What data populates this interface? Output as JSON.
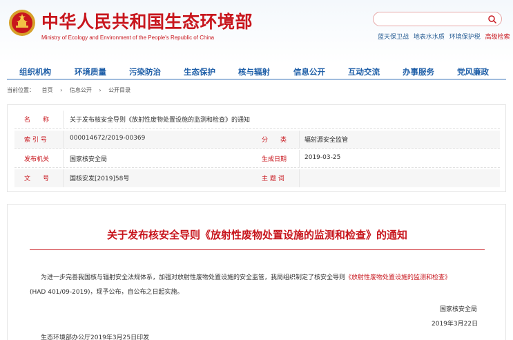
{
  "header": {
    "site_title": "中华人民共和国生态环境部",
    "site_subtitle": "Ministry of Ecology and Environment of the People's Republic of China",
    "search": {
      "placeholder": ""
    },
    "quick_links": [
      "蓝天保卫战",
      "地表水水质",
      "环境保护税"
    ],
    "advanced_search": "高级检索"
  },
  "nav": {
    "items": [
      "组织机构",
      "环境质量",
      "污染防治",
      "生态保护",
      "核与辐射",
      "信息公开",
      "互动交流",
      "办事服务",
      "党风廉政"
    ]
  },
  "breadcrumb": {
    "prefix": "当前位置：",
    "items": [
      "首页",
      "信息公开",
      "公开目录"
    ]
  },
  "info": {
    "name_label": "名　　称",
    "name_value": "关于发布核安全导则《放射性废物处置设施的监测和检查》的通知",
    "index_label": "索 引 号",
    "index_value": "000014672/2019-00369",
    "category_label": "分　　类",
    "category_value": "辐射源安全监管",
    "issuer_label": "发布机关",
    "issuer_value": "国家核安全局",
    "date_label": "生成日期",
    "date_value": "2019-03-25",
    "doc_label": "文　　号",
    "doc_value": "国核安发[2019]58号",
    "keywords_label": "主 题 词",
    "keywords_value": ""
  },
  "article": {
    "title": "关于发布核安全导则《放射性废物处置设施的监测和检查》的通知",
    "para1_a": "为进一步完善我国核与辐射安全法规体系，加强对放射性废物处置设施的安全监管，我局组织制定了核安全导则",
    "para1_link": "《放射性废物处置设施的监测和检查》",
    "para2": "(HAD 401/09-2019)，现予公布，自公布之日起实施。",
    "signature": "国家核安全局",
    "sign_date": "2019年3月22日",
    "footer_note": "生态环境部办公厅2019年3月25日印发"
  },
  "colors": {
    "brand_red": "#c8161d",
    "nav_blue": "#1f5fa8"
  }
}
